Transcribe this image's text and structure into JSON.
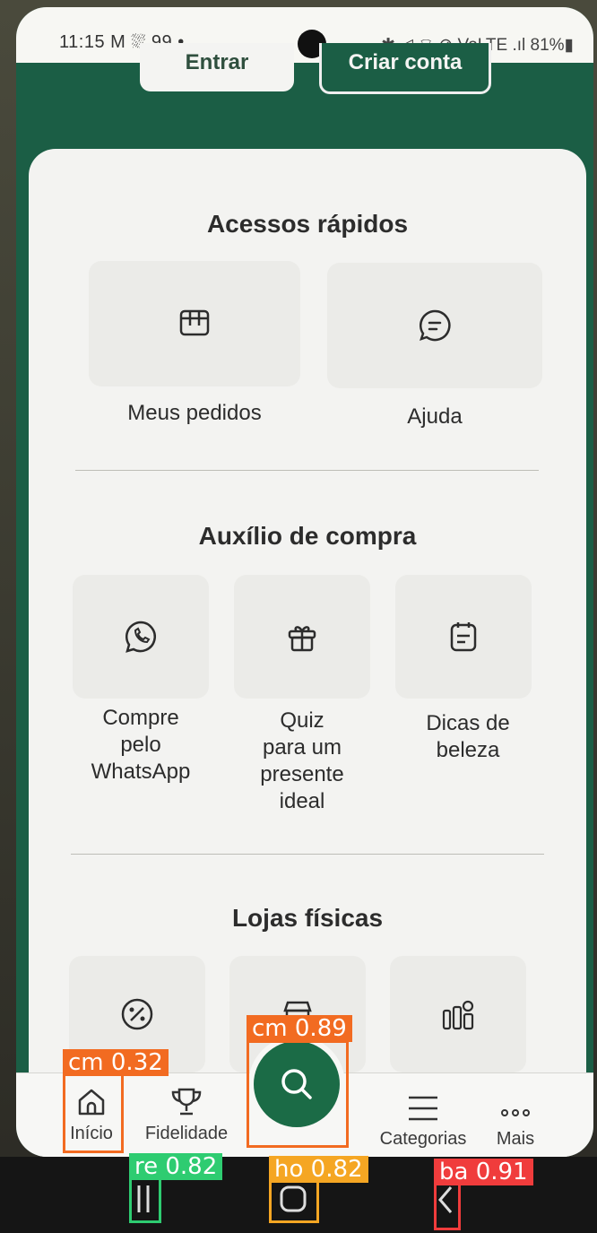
{
  "status_bar": {
    "time_and_icons": "11:15 M ⛆ 99 •",
    "right_icons": "✱ ◁ ⌔ ⊘ VoLTE .ıl 81%▮"
  },
  "header": {
    "login_label": "Entrar",
    "signup_label": "Criar conta"
  },
  "quick_access": {
    "title": "Acessos rápidos",
    "items": [
      {
        "label": "Meus pedidos",
        "icon": "orders-icon"
      },
      {
        "label": "Ajuda",
        "icon": "chat-icon"
      }
    ]
  },
  "purchase_help": {
    "title": "Auxílio de compra",
    "items": [
      {
        "label": "Compre\npelo\nWhatsApp",
        "icon": "whatsapp-icon"
      },
      {
        "label": "Quiz\npara um\npresente\nideal",
        "icon": "gift-icon"
      },
      {
        "label": "Dicas de\nbeleza",
        "icon": "notes-icon"
      }
    ]
  },
  "stores": {
    "title": "Lojas físicas",
    "items": [
      {
        "icon": "discount-icon"
      },
      {
        "icon": "store-icon"
      },
      {
        "icon": "cosmetics-icon"
      }
    ]
  },
  "bottom_nav": {
    "items": [
      {
        "label": "Início",
        "icon": "home-icon"
      },
      {
        "label": "Fidelidade",
        "icon": "trophy-icon"
      },
      {
        "label": "Categorias",
        "icon": "list-icon"
      },
      {
        "label": "Mais",
        "icon": "more-icon"
      }
    ],
    "search_icon": "search-icon"
  },
  "detections": [
    {
      "label": "cm 0.32",
      "color": "#f26b21"
    },
    {
      "label": "cm 0.89",
      "color": "#f26b21"
    },
    {
      "label": "re 0.82",
      "color": "#2ecc71"
    },
    {
      "label": "ho 0.82",
      "color": "#f5a623"
    },
    {
      "label": "ba 0.91",
      "color": "#f03c3c"
    }
  ],
  "colors": {
    "brand_green": "#1b5e45",
    "card_bg": "#f3f3f1",
    "tile_bg": "#ebebe8"
  }
}
